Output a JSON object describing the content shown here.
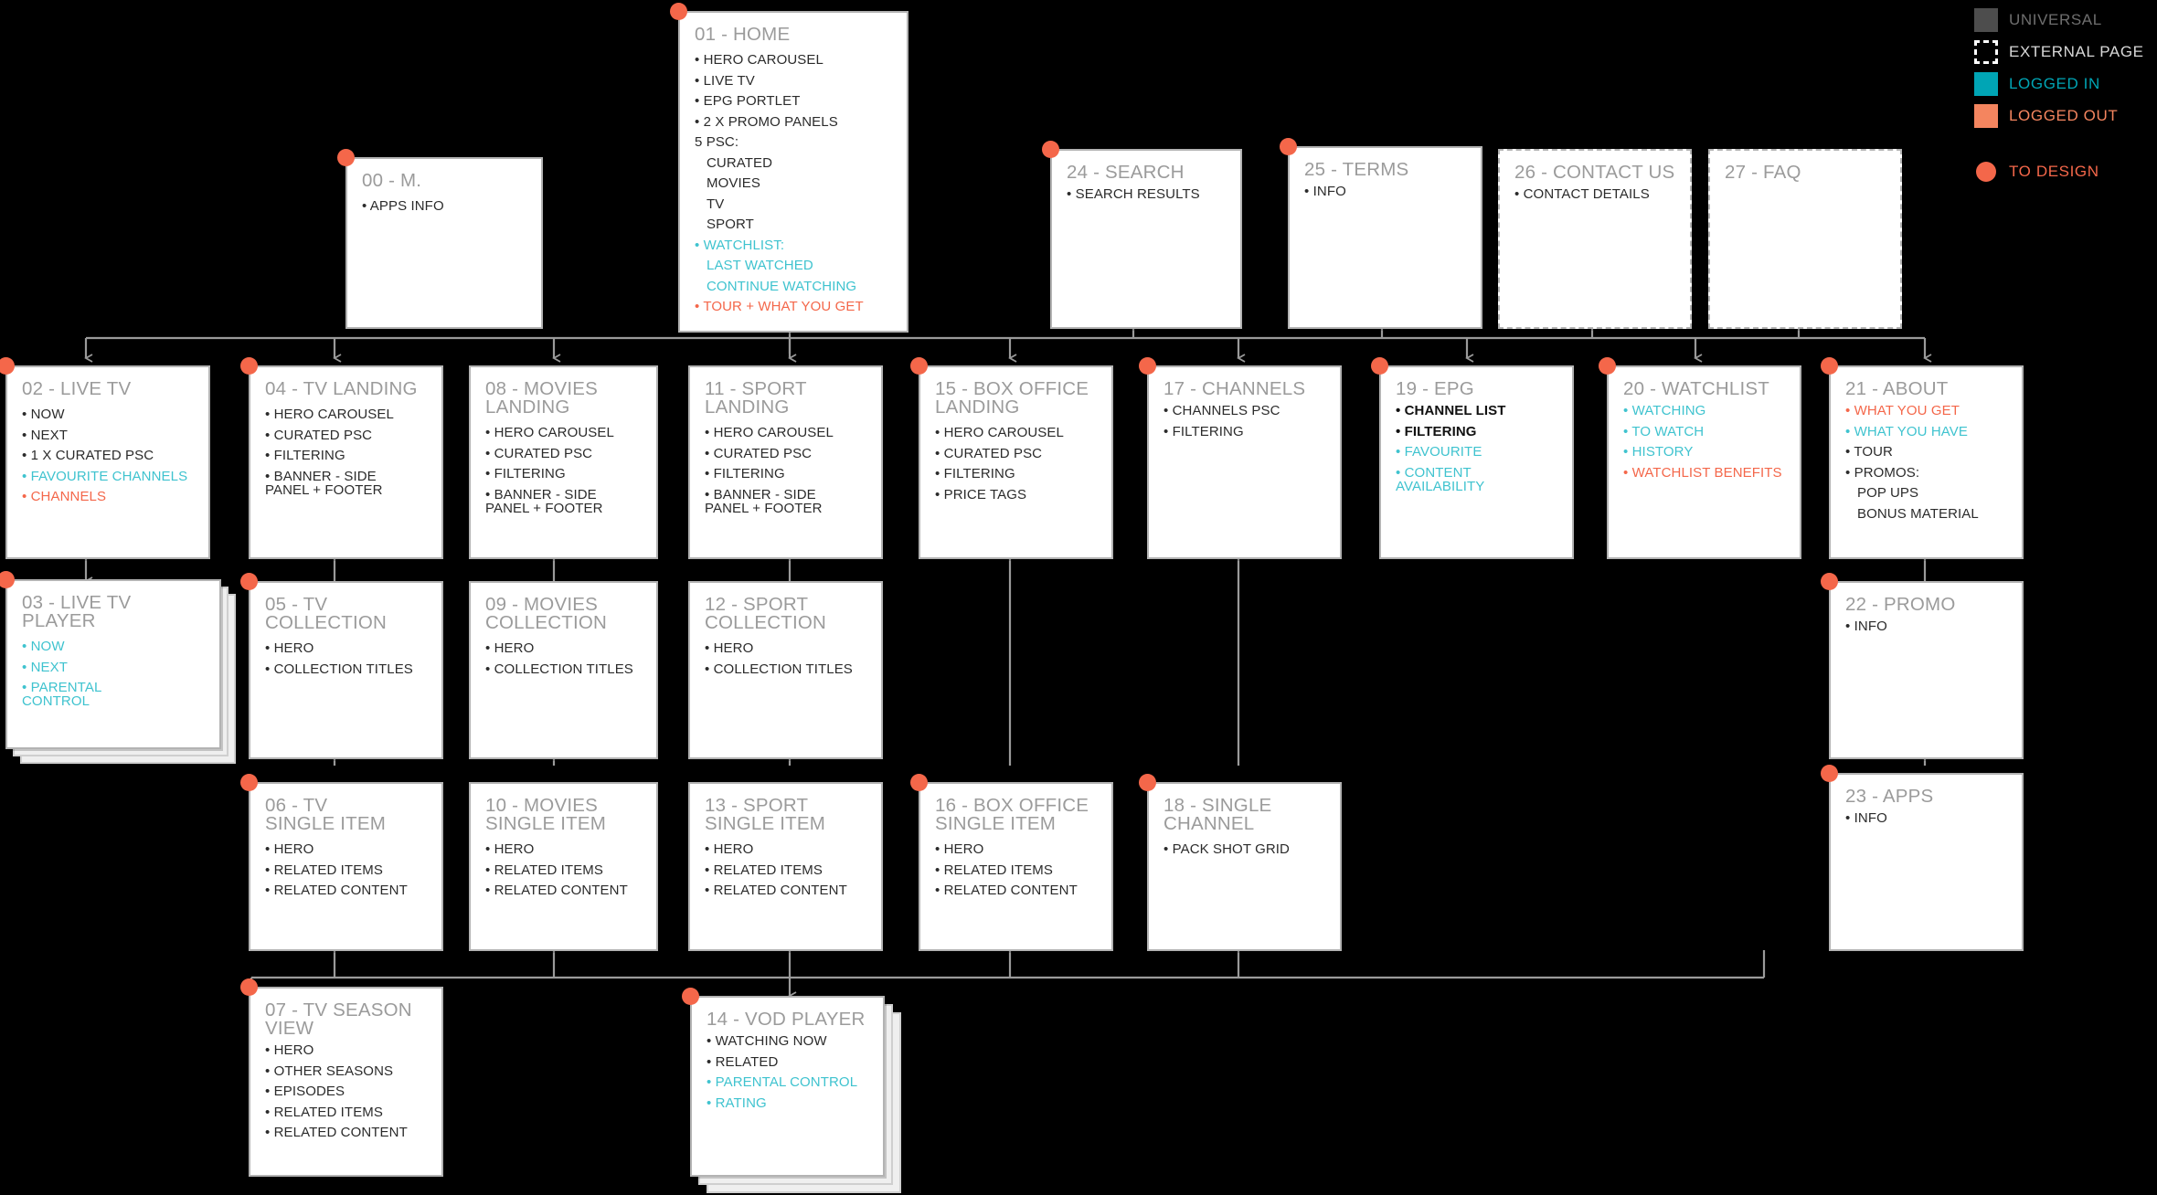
{
  "legend": {
    "rows": [
      {
        "key": "universal",
        "label": "UNIVERSAL",
        "color": "#4d4d4d"
      },
      {
        "key": "external",
        "label": "EXTERNAL PAGE",
        "color": "#ffffff"
      },
      {
        "key": "loggedin",
        "label": "LOGGED IN",
        "color": "#00a5b5"
      },
      {
        "key": "loggedout",
        "label": "LOGGED OUT",
        "color": "#f4855f"
      },
      {
        "key": "todesign",
        "label": "TO DESIGN",
        "color": "#f4674a"
      }
    ]
  },
  "colors": {
    "accent_orange": "#f4674a",
    "accent_teal": "#3fc3cf",
    "legend_teal": "#00a5b5",
    "legend_orange": "#f4855f",
    "card_border": "#b3b3b3",
    "title_grey": "#9b9b9b",
    "body_text": "#2b2b2b",
    "background": "#000000"
  },
  "cards": {
    "c00": {
      "title": "00 - M.",
      "items": [
        {
          "text": "• APPS INFO",
          "style": "normal"
        }
      ]
    },
    "c01": {
      "title": "01 - HOME",
      "items": [
        {
          "text": "• HERO CAROUSEL",
          "style": "normal"
        },
        {
          "text": "• LIVE TV",
          "style": "normal"
        },
        {
          "text": "• EPG PORTLET",
          "style": "normal"
        },
        {
          "text": "• 2 X PROMO PANELS",
          "style": "normal"
        },
        {
          "text": "5 PSC:",
          "style": "normal"
        },
        {
          "text": "CURATED",
          "style": "sub"
        },
        {
          "text": "MOVIES",
          "style": "sub"
        },
        {
          "text": "TV",
          "style": "sub"
        },
        {
          "text": "SPORT",
          "style": "sub"
        },
        {
          "text": "•  WATCHLIST:",
          "style": "teal"
        },
        {
          "text": "LAST WATCHED",
          "style": "teal-sub"
        },
        {
          "text": "CONTINUE WATCHING",
          "style": "teal-sub"
        },
        {
          "text": "• TOUR + WHAT YOU GET",
          "style": "orange"
        }
      ]
    },
    "c24": {
      "title": "24 - SEARCH",
      "items": [
        {
          "text": "• SEARCH RESULTS",
          "style": "normal"
        }
      ]
    },
    "c25": {
      "title": "25 - TERMS",
      "items": [
        {
          "text": "• INFO",
          "style": "normal"
        }
      ]
    },
    "c26": {
      "title": "26 - CONTACT US",
      "items": [
        {
          "text": "• CONTACT DETAILS",
          "style": "normal"
        }
      ],
      "external": true
    },
    "c27": {
      "title": "27 - FAQ",
      "items": [],
      "external": true
    },
    "c02": {
      "title": "02 - LIVE TV",
      "items": [
        {
          "text": "• NOW",
          "style": "normal"
        },
        {
          "text": "• NEXT",
          "style": "normal"
        },
        {
          "text": "• 1 X CURATED PSC",
          "style": "normal"
        },
        {
          "text": "• FAVOURITE CHANNELS",
          "style": "teal"
        },
        {
          "text": "• CHANNELS",
          "style": "orange"
        }
      ]
    },
    "c04": {
      "title": "04 - TV LANDING",
      "items": [
        {
          "text": "• HERO CAROUSEL",
          "style": "normal"
        },
        {
          "text": "• CURATED PSC",
          "style": "normal"
        },
        {
          "text": "• FILTERING",
          "style": "normal"
        },
        {
          "text": "• BANNER - SIDE\n   PANEL + FOOTER",
          "style": "normal"
        }
      ]
    },
    "c08": {
      "title": "08 - MOVIES\n LANDING",
      "items": [
        {
          "text": "• HERO CAROUSEL",
          "style": "normal"
        },
        {
          "text": "• CURATED PSC",
          "style": "normal"
        },
        {
          "text": "• FILTERING",
          "style": "normal"
        },
        {
          "text": "• BANNER - SIDE\n   PANEL + FOOTER",
          "style": "normal"
        }
      ]
    },
    "c11": {
      "title": "11 - SPORT\n LANDING",
      "items": [
        {
          "text": "• HERO CAROUSEL",
          "style": "normal"
        },
        {
          "text": "• CURATED PSC",
          "style": "normal"
        },
        {
          "text": "• FILTERING",
          "style": "normal"
        },
        {
          "text": "• BANNER - SIDE\n   PANEL + FOOTER",
          "style": "normal"
        }
      ]
    },
    "c15": {
      "title": "15 - BOX OFFICE\n LANDING",
      "items": [
        {
          "text": "• HERO CAROUSEL",
          "style": "normal"
        },
        {
          "text": "• CURATED PSC",
          "style": "normal"
        },
        {
          "text": "• FILTERING",
          "style": "normal"
        },
        {
          "text": "• PRICE TAGS",
          "style": "normal"
        }
      ]
    },
    "c17": {
      "title": "17 - CHANNELS",
      "items": [
        {
          "text": "• CHANNELS PSC",
          "style": "normal"
        },
        {
          "text": "• FILTERING",
          "style": "normal"
        }
      ]
    },
    "c19": {
      "title": "19 - EPG",
      "items": [
        {
          "text": "• CHANNEL LIST",
          "style": "bold"
        },
        {
          "text": "• FILTERING",
          "style": "bold"
        },
        {
          "text": "• FAVOURITE",
          "style": "teal"
        },
        {
          "text": "• CONTENT AVAILABILITY",
          "style": "teal"
        }
      ]
    },
    "c20": {
      "title": "20 - WATCHLIST",
      "items": [
        {
          "text": "• WATCHING",
          "style": "teal"
        },
        {
          "text": "• TO WATCH",
          "style": "teal"
        },
        {
          "text": "• HISTORY",
          "style": "teal"
        },
        {
          "text": "• WATCHLIST BENEFITS",
          "style": "orange"
        }
      ]
    },
    "c21": {
      "title": "21 - ABOUT",
      "items": [
        {
          "text": "• WHAT YOU GET",
          "style": "orange"
        },
        {
          "text": "• WHAT YOU HAVE",
          "style": "teal"
        },
        {
          "text": "• TOUR",
          "style": "normal"
        },
        {
          "text": "• PROMOS:",
          "style": "normal"
        },
        {
          "text": "POP UPS",
          "style": "sub"
        },
        {
          "text": "BONUS MATERIAL",
          "style": "sub"
        }
      ]
    },
    "c03": {
      "title": "03 - LIVE TV PLAYER",
      "items": [
        {
          "text": "• NOW",
          "style": "teal"
        },
        {
          "text": "• NEXT",
          "style": "teal"
        },
        {
          "text": "• PARENTAL\n   CONTROL",
          "style": "teal"
        }
      ],
      "stacked": true
    },
    "c05": {
      "title": "05 - TV\nCOLLECTION",
      "items": [
        {
          "text": "• HERO",
          "style": "normal"
        },
        {
          "text": "• COLLECTION TITLES",
          "style": "normal"
        }
      ]
    },
    "c09": {
      "title": "09 - MOVIES\nCOLLECTION",
      "items": [
        {
          "text": "• HERO",
          "style": "normal"
        },
        {
          "text": "• COLLECTION TITLES",
          "style": "normal"
        }
      ]
    },
    "c12": {
      "title": "12 - SPORT\nCOLLECTION",
      "items": [
        {
          "text": "• HERO",
          "style": "normal"
        },
        {
          "text": "• COLLECTION TITLES",
          "style": "normal"
        }
      ]
    },
    "c22": {
      "title": "22 - PROMO",
      "items": [
        {
          "text": "• INFO",
          "style": "normal"
        }
      ]
    },
    "c06": {
      "title": "06 - TV\nSINGLE ITEM",
      "items": [
        {
          "text": "• HERO",
          "style": "normal"
        },
        {
          "text": "• RELATED ITEMS",
          "style": "normal"
        },
        {
          "text": "• RELATED CONTENT",
          "style": "normal"
        }
      ]
    },
    "c10": {
      "title": "10 - MOVIES\nSINGLE ITEM",
      "items": [
        {
          "text": "• HERO",
          "style": "normal"
        },
        {
          "text": "• RELATED ITEMS",
          "style": "normal"
        },
        {
          "text": "• RELATED CONTENT",
          "style": "normal"
        }
      ]
    },
    "c13": {
      "title": "13 - SPORT\nSINGLE ITEM",
      "items": [
        {
          "text": "• HERO",
          "style": "normal"
        },
        {
          "text": "• RELATED ITEMS",
          "style": "normal"
        },
        {
          "text": "• RELATED CONTENT",
          "style": "normal"
        }
      ]
    },
    "c16": {
      "title": "16 - BOX OFFICE\nSINGLE ITEM",
      "items": [
        {
          "text": "• HERO",
          "style": "normal"
        },
        {
          "text": "• RELATED ITEMS",
          "style": "normal"
        },
        {
          "text": "• RELATED CONTENT",
          "style": "normal"
        }
      ]
    },
    "c18": {
      "title": "18 - SINGLE\nCHANNEL",
      "items": [
        {
          "text": "• PACK SHOT GRID",
          "style": "normal"
        }
      ]
    },
    "c23": {
      "title": "23 - APPS",
      "items": [
        {
          "text": "• INFO",
          "style": "normal"
        }
      ]
    },
    "c07": {
      "title": "07 - TV SEASON\nVIEW",
      "items": [
        {
          "text": "• HERO",
          "style": "normal"
        },
        {
          "text": "• OTHER SEASONS",
          "style": "normal"
        },
        {
          "text": "• EPISODES",
          "style": "normal"
        },
        {
          "text": "• RELATED ITEMS",
          "style": "normal"
        },
        {
          "text": "• RELATED CONTENT",
          "style": "normal"
        }
      ]
    },
    "c14": {
      "title": "14 - VOD PLAYER",
      "items": [
        {
          "text": "• WATCHING NOW",
          "style": "normal"
        },
        {
          "text": "• RELATED",
          "style": "normal"
        },
        {
          "text": "• PARENTAL CONTROL",
          "style": "teal"
        },
        {
          "text": "• RATING",
          "style": "teal"
        }
      ],
      "stacked": true
    }
  }
}
